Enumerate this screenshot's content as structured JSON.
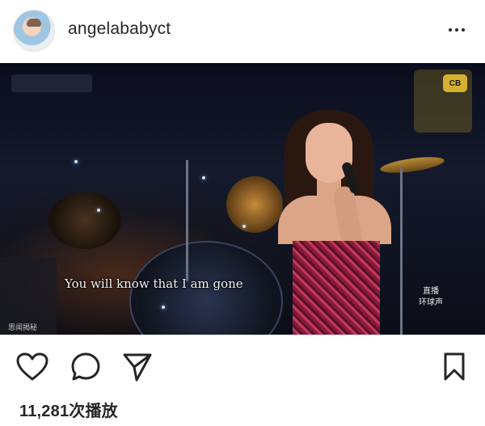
{
  "post": {
    "username": "angelababyct",
    "views": "11,281次播放"
  },
  "media": {
    "subtitle": "You will know that I am gone",
    "live_label": "直播",
    "live_sublabel": "环球声",
    "corner_label": "恩闻揭秘",
    "tv_logo": "CB"
  },
  "icons": {
    "more": "more-options-icon",
    "like": "heart-icon",
    "comment": "comment-bubble-icon",
    "share": "paper-plane-icon",
    "save": "bookmark-icon"
  },
  "colors": {
    "text": "#262626",
    "background": "#ffffff"
  }
}
